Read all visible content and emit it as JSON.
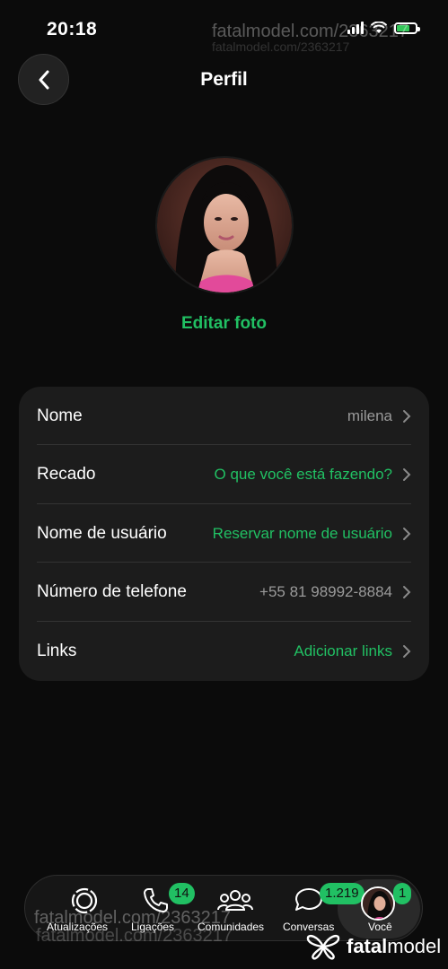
{
  "status_bar": {
    "time": "20:18",
    "battery_color": "#34c759"
  },
  "watermarks": {
    "top": "fatalmodel.com/2363217",
    "top_faint": "fatalmodel.com/2363217",
    "bottom": "fatalmodel.com/2363217",
    "bottom_faint": "fatalmodel.com/2363217"
  },
  "header": {
    "title": "Perfil",
    "back_icon": "chevron-left-icon"
  },
  "profile": {
    "edit_photo_label": "Editar foto"
  },
  "fields": [
    {
      "label": "Nome",
      "value": "milena",
      "accent": false
    },
    {
      "label": "Recado",
      "value": "O que você está fazendo?",
      "accent": true
    },
    {
      "label": "Nome de usuário",
      "value": "Reservar nome de usuário",
      "accent": true
    },
    {
      "label": "Número de telefone",
      "value": "+55 81 98992-8884",
      "accent": false
    },
    {
      "label": "Links",
      "value": "Adicionar links",
      "accent": true
    }
  ],
  "bottom_nav": {
    "items": [
      {
        "label": "Atualizações",
        "icon": "updates-icon"
      },
      {
        "label": "Ligações",
        "icon": "phone-icon",
        "badge": "14"
      },
      {
        "label": "Comunidades",
        "icon": "communities-icon"
      },
      {
        "label": "Conversas",
        "icon": "chat-icon",
        "badge": "1.219"
      },
      {
        "label": "Você",
        "icon": "avatar",
        "badge": "1",
        "selected": true
      }
    ]
  },
  "brand": {
    "name_part1": "fatal",
    "name_part2": "model"
  },
  "colors": {
    "accent": "#21c063",
    "background": "#0b0b0b",
    "card": "#1c1c1c"
  }
}
